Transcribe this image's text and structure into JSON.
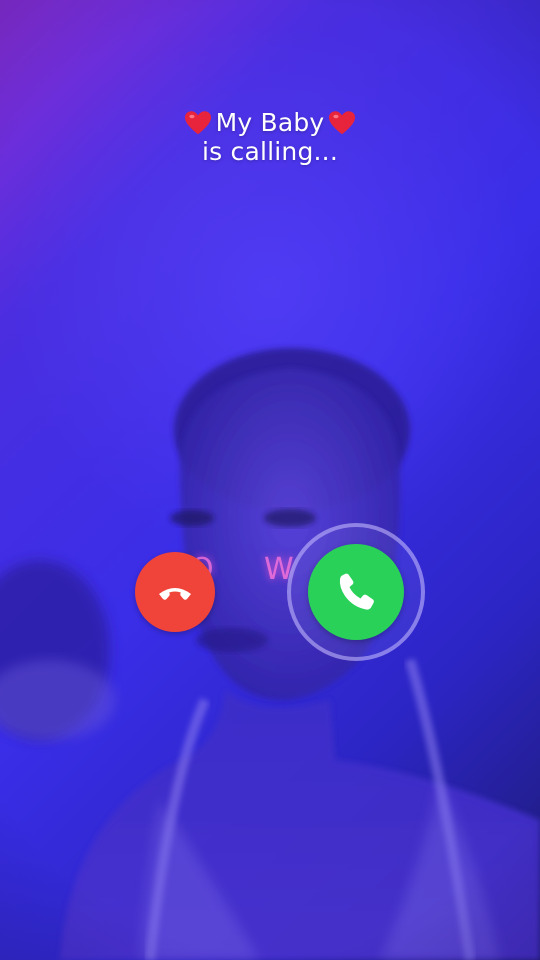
{
  "call": {
    "caller_name": "My Baby",
    "status": "is calling..."
  },
  "background_neon": {
    "left": "O",
    "right": "W"
  },
  "icons": {
    "heart": "red-heart-emoji",
    "decline": "phone-hangup-icon",
    "accept": "phone-icon"
  },
  "colors": {
    "decline": "#f0443a",
    "accept": "#2ad159",
    "heart": "#e8243c"
  }
}
